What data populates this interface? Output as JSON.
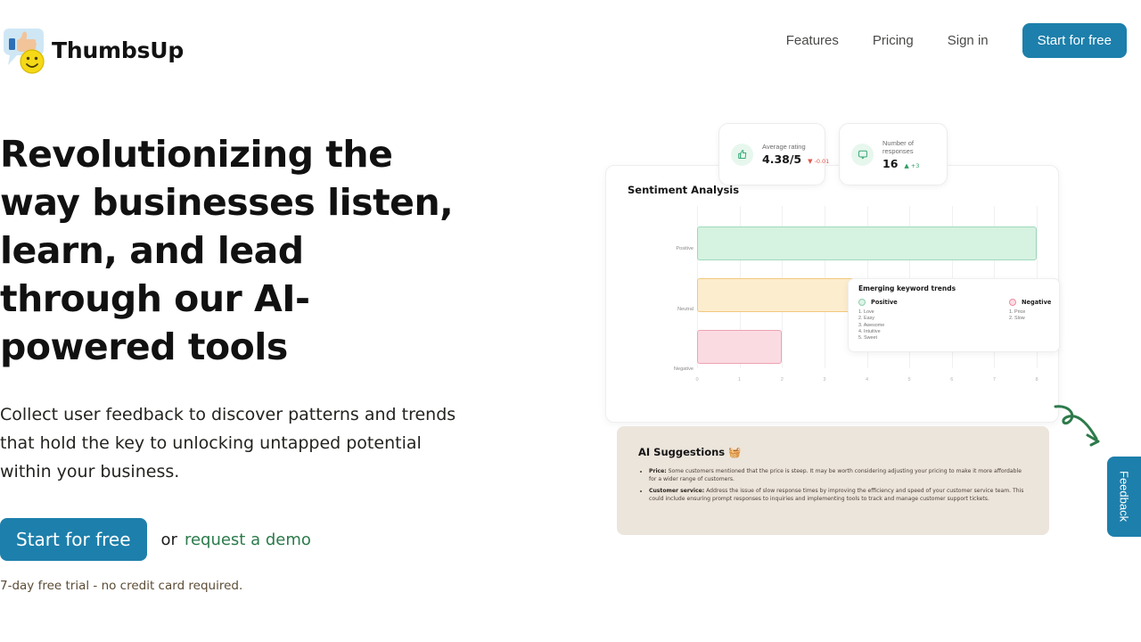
{
  "header": {
    "brand_name": "ThumbsUp",
    "logo_icon": "thumbs-up-speech-bubble-smiley-logo",
    "nav": [
      {
        "label": "Features"
      },
      {
        "label": "Pricing"
      },
      {
        "label": "Sign in"
      }
    ],
    "cta_label": "Start for free"
  },
  "hero": {
    "heading_part1": "Revolutionizing the way businesses listen, learn, and lead through our ",
    "heading_highlight": "AI-powered",
    "heading_part2": " tools",
    "highlight_color": "#ffe01b",
    "subtext": "Collect user feedback to discover patterns and trends that hold the key to unlocking untapped potential within your business.",
    "primary_cta": "Start for free",
    "or_text": "or",
    "demo_link": "request a demo",
    "trial_note": "7-day free trial - no credit card required.",
    "primary_color": "#1d7fab",
    "link_color": "#2b7a4b"
  },
  "dashboard": {
    "stats": [
      {
        "icon": "thumbs-up-icon",
        "label": "Average rating",
        "value": "4.38/5",
        "delta": "-0.01",
        "delta_direction": "down",
        "delta_arrow": "▼",
        "delta_color": "#e2574c"
      },
      {
        "icon": "chat-bubble-icon",
        "label": "Number of responses",
        "value": "16",
        "delta": "+3",
        "delta_direction": "up",
        "delta_arrow": "▲",
        "delta_color": "#2e9e63"
      }
    ],
    "chart_panel_title": "Sentiment Analysis",
    "keywords_panel": {
      "title": "Emerging keyword trends",
      "positive": {
        "label": "Positive",
        "items": [
          "1. Love",
          "2. Easy",
          "3. Awesome",
          "4. Intuitive",
          "5. Sweet"
        ]
      },
      "negative": {
        "label": "Negative",
        "items": [
          "1. Price",
          "2. Slow"
        ]
      }
    },
    "ai_panel": {
      "title": "AI Suggestions 🧺",
      "items": [
        {
          "term": "Price:",
          "body": " Some customers mentioned that the price is steep. It may be worth considering adjusting your pricing to make it more affordable for a wider range of customers."
        },
        {
          "term": "Customer service:",
          "body": " Address the issue of slow response times by improving the efficiency and speed of your customer service team. This could include ensuring prompt responses to inquiries and implementing tools to track and manage customer support tickets."
        }
      ]
    },
    "feedback_tab_label": "Feedback",
    "arrow_icon": "curved-arrow-icon",
    "arrow_color": "#2d7a4a"
  },
  "chart_data": {
    "type": "bar",
    "orientation": "horizontal",
    "title": "Sentiment Analysis",
    "categories": [
      "Positive",
      "Neutral",
      "Negative"
    ],
    "values": [
      8,
      4,
      2
    ],
    "colors": [
      "#d6f2e1",
      "#fdedcf",
      "#fbdbe2"
    ],
    "border_colors": [
      "#9fd9bb",
      "#f1c97e",
      "#eda3b3"
    ],
    "xlabel": "",
    "ylabel": "",
    "xlim": [
      0,
      8
    ],
    "xticks": [
      "0",
      "1",
      "2",
      "3",
      "4",
      "5",
      "6",
      "7",
      "8"
    ],
    "grid": true,
    "legend": false
  }
}
